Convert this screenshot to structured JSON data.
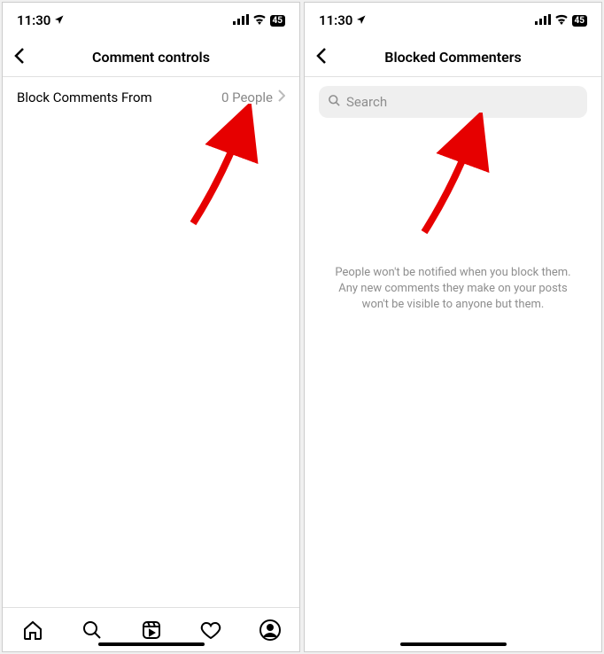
{
  "status": {
    "time": "11:30",
    "battery": "45"
  },
  "left": {
    "title": "Comment controls",
    "row": {
      "label": "Block Comments From",
      "value": "0 People"
    }
  },
  "right": {
    "title": "Blocked Commenters",
    "search_placeholder": "Search",
    "info": "People won't be notified when you block them. Any new comments they make on your posts won't be visible to anyone but them."
  }
}
